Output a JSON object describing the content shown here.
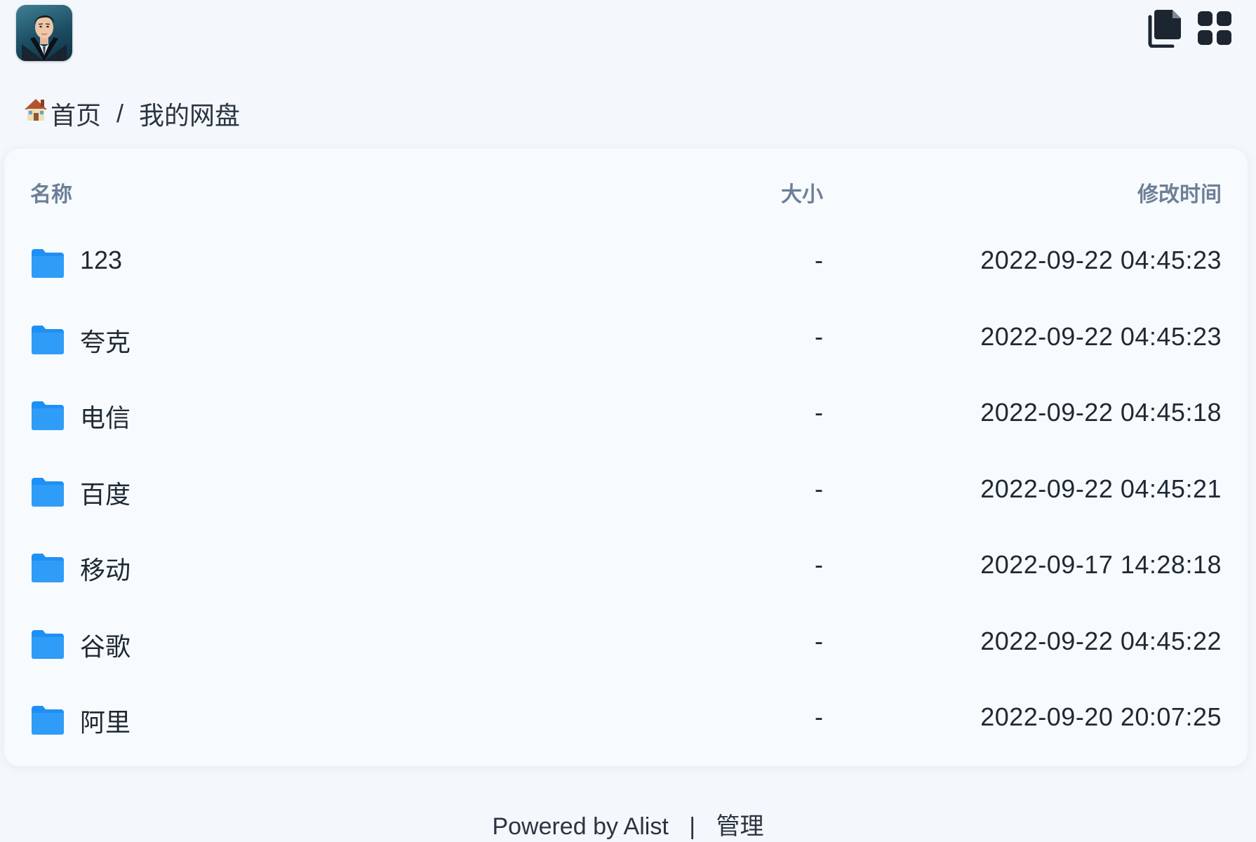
{
  "header": {
    "avatar_icon": "avatar-icon",
    "actions": [
      {
        "icon": "copy-icon"
      },
      {
        "icon": "grid-view-icon"
      }
    ]
  },
  "breadcrumb": {
    "home_icon": "house-icon",
    "home_label": "首页",
    "separator": "/",
    "current": "我的网盘"
  },
  "table": {
    "columns": {
      "name": "名称",
      "size": "大小",
      "modified": "修改时间"
    },
    "rows": [
      {
        "name": "123",
        "size": "-",
        "modified": "2022-09-22 04:45:23",
        "icon": "folder-icon"
      },
      {
        "name": "夸克",
        "size": "-",
        "modified": "2022-09-22 04:45:23",
        "icon": "folder-icon"
      },
      {
        "name": "电信",
        "size": "-",
        "modified": "2022-09-22 04:45:18",
        "icon": "folder-icon"
      },
      {
        "name": "百度",
        "size": "-",
        "modified": "2022-09-22 04:45:21",
        "icon": "folder-icon"
      },
      {
        "name": "移动",
        "size": "-",
        "modified": "2022-09-17 14:28:18",
        "icon": "folder-icon"
      },
      {
        "name": "谷歌",
        "size": "-",
        "modified": "2022-09-22 04:45:22",
        "icon": "folder-icon"
      },
      {
        "name": "阿里",
        "size": "-",
        "modified": "2022-09-20 20:07:25",
        "icon": "folder-icon"
      }
    ]
  },
  "footer": {
    "powered": "Powered by Alist",
    "separator": "|",
    "admin": "管理"
  },
  "colors": {
    "background": "#f4f8fc",
    "card": "#f7fbfe",
    "folder": "#1e90f5",
    "header_text": "#6d7f98",
    "icon_dark": "#1c2530"
  }
}
